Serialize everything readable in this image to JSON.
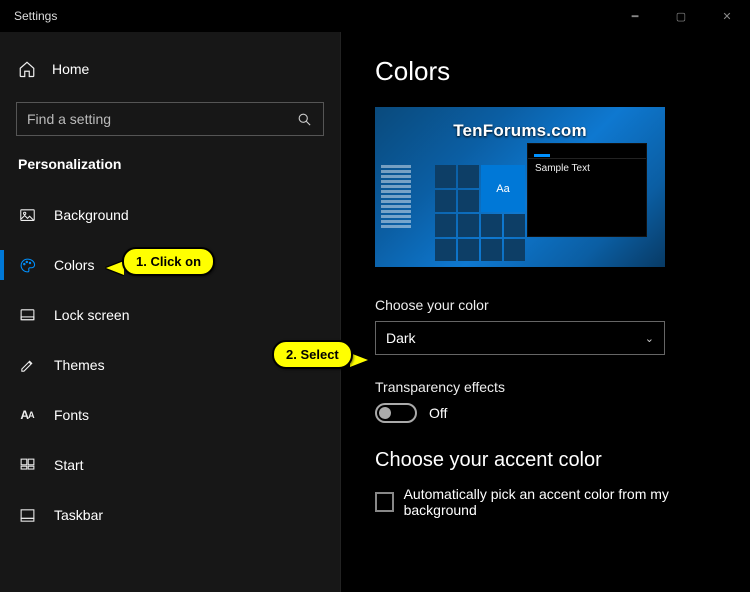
{
  "window": {
    "title": "Settings"
  },
  "sidebar": {
    "home": "Home",
    "search_placeholder": "Find a setting",
    "section": "Personalization",
    "items": [
      {
        "label": "Background"
      },
      {
        "label": "Colors"
      },
      {
        "label": "Lock screen"
      },
      {
        "label": "Themes"
      },
      {
        "label": "Fonts"
      },
      {
        "label": "Start"
      },
      {
        "label": "Taskbar"
      }
    ]
  },
  "main": {
    "title": "Colors",
    "watermark": "TenForums.com",
    "preview_tile_label": "Aa",
    "preview_sample": "Sample Text",
    "choose_color_label": "Choose your color",
    "choose_color_value": "Dark",
    "transparency_label": "Transparency effects",
    "transparency_state": "Off",
    "accent_heading": "Choose your accent color",
    "auto_accent_label": "Automatically pick an accent color from my background"
  },
  "callouts": {
    "c1": "1. Click on",
    "c2": "2. Select"
  }
}
